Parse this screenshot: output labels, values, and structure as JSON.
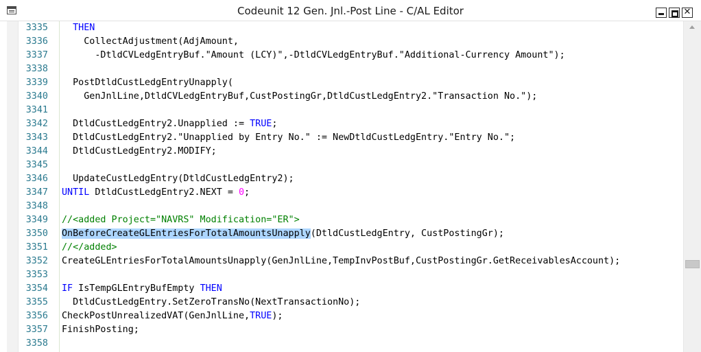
{
  "window": {
    "title": "Codeunit 12 Gen. Jnl.-Post Line - C/AL Editor",
    "close_glyph": "✕"
  },
  "scrollbar": {
    "position_fraction": 0.73
  },
  "colors": {
    "keyword": "#0000ff",
    "number": "#ff00ff",
    "comment": "#008000",
    "line_number": "#2b7a8f",
    "selection": "#add6ff"
  },
  "editor": {
    "lines": [
      {
        "n": "3335",
        "segs": [
          {
            "t": "  "
          },
          {
            "t": "THEN",
            "c": "kw"
          }
        ]
      },
      {
        "n": "3336",
        "segs": [
          {
            "t": "    CollectAdjustment(AdjAmount,"
          }
        ]
      },
      {
        "n": "3337",
        "segs": [
          {
            "t": "      -DtldCVLedgEntryBuf.\"Amount (LCY)\",-DtldCVLedgEntryBuf.\"Additional-Currency Amount\");"
          }
        ]
      },
      {
        "n": "3338",
        "segs": []
      },
      {
        "n": "3339",
        "segs": [
          {
            "t": "  PostDtldCustLedgEntryUnapply("
          }
        ]
      },
      {
        "n": "3340",
        "segs": [
          {
            "t": "    GenJnlLine,DtldCVLedgEntryBuf,CustPostingGr,DtldCustLedgEntry2.\"Transaction No.\");"
          }
        ]
      },
      {
        "n": "3341",
        "segs": []
      },
      {
        "n": "3342",
        "segs": [
          {
            "t": "  DtldCustLedgEntry2.Unapplied := "
          },
          {
            "t": "TRUE",
            "c": "kw"
          },
          {
            "t": ";"
          }
        ]
      },
      {
        "n": "3343",
        "segs": [
          {
            "t": "  DtldCustLedgEntry2.\"Unapplied by Entry No.\" := NewDtldCustLedgEntry.\"Entry No.\";"
          }
        ]
      },
      {
        "n": "3344",
        "segs": [
          {
            "t": "  DtldCustLedgEntry2.MODIFY;"
          }
        ]
      },
      {
        "n": "3345",
        "segs": []
      },
      {
        "n": "3346",
        "segs": [
          {
            "t": "  UpdateCustLedgEntry(DtldCustLedgEntry2);"
          }
        ]
      },
      {
        "n": "3347",
        "segs": [
          {
            "t": "UNTIL",
            "c": "kw"
          },
          {
            "t": " DtldCustLedgEntry2.NEXT = "
          },
          {
            "t": "0",
            "c": "num"
          },
          {
            "t": ";"
          }
        ]
      },
      {
        "n": "3348",
        "segs": []
      },
      {
        "n": "3349",
        "segs": [
          {
            "t": "//<added Project=\"NAVRS\" Modification=\"ER\">",
            "c": "cm"
          }
        ]
      },
      {
        "n": "3350",
        "segs": [
          {
            "t": "OnBeforeCreateGLEntriesForTotalAmountsUnapply",
            "c": "hl"
          },
          {
            "t": "(DtldCustLedgEntry, CustPostingGr);"
          }
        ]
      },
      {
        "n": "3351",
        "segs": [
          {
            "t": "//</added>",
            "c": "cm"
          }
        ]
      },
      {
        "n": "3352",
        "segs": [
          {
            "t": "CreateGLEntriesForTotalAmountsUnapply(GenJnlLine,TempInvPostBuf,CustPostingGr.GetReceivablesAccount);"
          }
        ]
      },
      {
        "n": "3353",
        "segs": []
      },
      {
        "n": "3354",
        "segs": [
          {
            "t": "IF",
            "c": "kw"
          },
          {
            "t": " IsTempGLEntryBufEmpty "
          },
          {
            "t": "THEN",
            "c": "kw"
          }
        ]
      },
      {
        "n": "3355",
        "segs": [
          {
            "t": "  DtldCustLedgEntry.SetZeroTransNo(NextTransactionNo);"
          }
        ]
      },
      {
        "n": "3356",
        "segs": [
          {
            "t": "CheckPostUnrealizedVAT(GenJnlLine,"
          },
          {
            "t": "TRUE",
            "c": "kw"
          },
          {
            "t": ");"
          }
        ]
      },
      {
        "n": "3357",
        "segs": [
          {
            "t": "FinishPosting;"
          }
        ]
      },
      {
        "n": "3358",
        "segs": []
      }
    ]
  }
}
